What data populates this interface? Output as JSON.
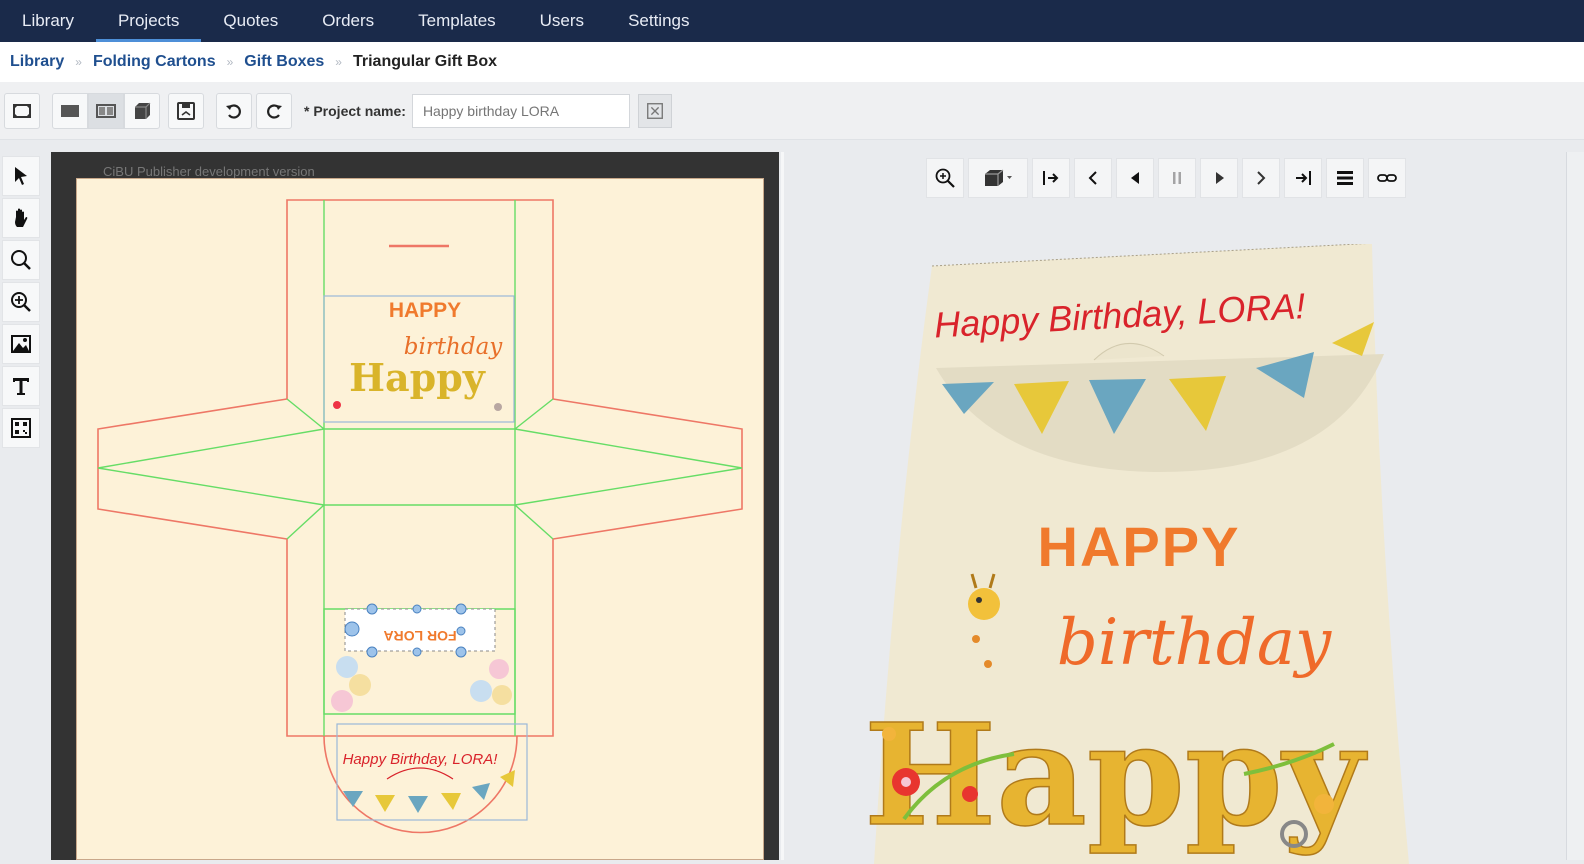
{
  "nav": {
    "tabs": [
      {
        "label": "Library",
        "active": false
      },
      {
        "label": "Projects",
        "active": true
      },
      {
        "label": "Quotes",
        "active": false
      },
      {
        "label": "Orders",
        "active": false
      },
      {
        "label": "Templates",
        "active": false
      },
      {
        "label": "Users",
        "active": false
      },
      {
        "label": "Settings",
        "active": false
      }
    ]
  },
  "breadcrumb": {
    "items": [
      "Library",
      "Folding Cartons",
      "Gift Boxes"
    ],
    "current": "Triangular Gift Box",
    "separator": "»"
  },
  "toolbar": {
    "project_name_label": "* Project name:",
    "project_name_placeholder": "Happy birthday LORA",
    "icons": [
      "fit-to-screen-icon",
      "view-2d-icon",
      "view-split-icon",
      "view-3d-icon",
      "save-icon",
      "undo-icon",
      "redo-icon",
      "clear-icon"
    ]
  },
  "tools": [
    "select-arrow-icon",
    "hand-pan-icon",
    "zoom-icon",
    "zoom-in-icon",
    "image-icon",
    "text-icon",
    "barcode-icon"
  ],
  "canvas": {
    "watermark": "CiBU Publisher development version",
    "panel_greeting": "Happy Birthday, LORA!",
    "panel_happy": "HAPPY",
    "panel_birthday": "birthday",
    "panel_script": "Happy",
    "panel_name_flipped": "FOR LORA"
  },
  "preview": {
    "controls": [
      "zoom-fit-icon",
      "render-mode-icon",
      "first-frame-icon",
      "prev-step-icon",
      "prev-frame-icon",
      "pause-icon",
      "play-icon",
      "next-step-icon",
      "last-frame-icon",
      "layers-icon",
      "link-icon"
    ],
    "bag_greeting": "Happy Birthday, LORA!",
    "bag_happy": "HAPPY",
    "bag_birthday": "birthday",
    "bag_script": "Happy"
  },
  "colors": {
    "nav_bg": "#1a2a4a",
    "accent": "#4d8fd8",
    "cut_line": "#ee7766",
    "fold_line": "#66dd66",
    "artboard": "#fdf2d8",
    "greeting_red": "#d9232b",
    "happy_orange": "#f07a2d",
    "bunting_blue": "#6aa6c0",
    "bunting_yellow": "#e7c83a"
  }
}
